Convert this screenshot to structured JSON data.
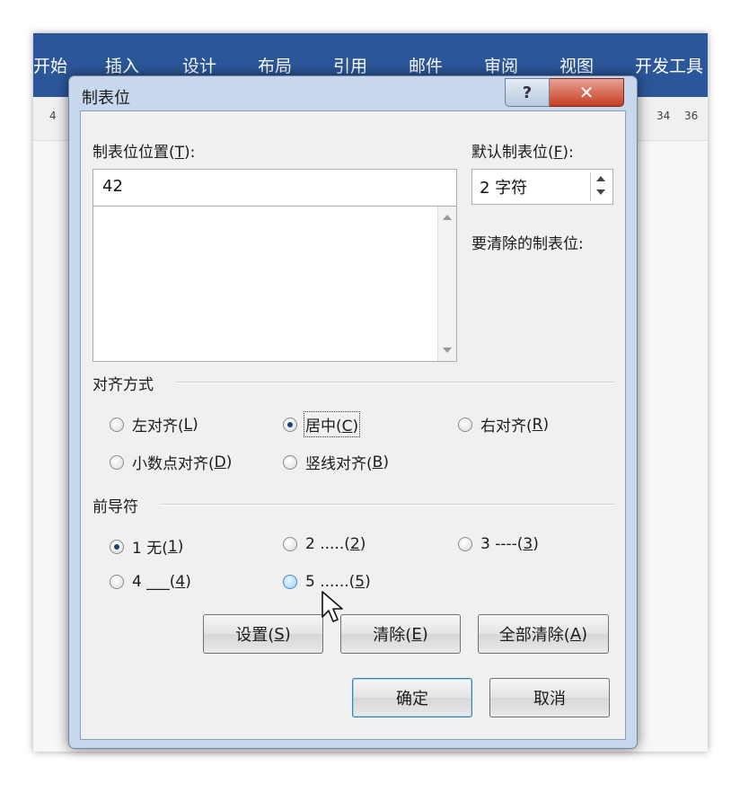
{
  "word": {
    "ribbon_tabs": [
      "开始",
      "插入",
      "设计",
      "布局",
      "引用",
      "邮件",
      "审阅",
      "视图",
      "开发工具"
    ],
    "ruler_left": "4",
    "ruler_right": [
      "34",
      "36"
    ]
  },
  "dialog": {
    "title": "制表位",
    "help_label": "?",
    "close_label": "✕",
    "tab_position": {
      "label_text": "制表位位置(",
      "label_key": "T",
      "label_end": "):",
      "value": "42",
      "list_items": []
    },
    "default_tab": {
      "label_text": "默认制表位(",
      "label_key": "F",
      "label_end": "):",
      "value": "2 字符"
    },
    "to_clear_label": "要清除的制表位:",
    "alignment": {
      "title": "对齐方式",
      "options": [
        {
          "text": "左对齐(",
          "key": "L",
          "end": ")",
          "checked": false
        },
        {
          "text": "居中(",
          "key": "C",
          "end": ")",
          "checked": true
        },
        {
          "text": "右对齐(",
          "key": "R",
          "end": ")",
          "checked": false
        },
        {
          "text": "小数点对齐(",
          "key": "D",
          "end": ")",
          "checked": false
        },
        {
          "text": "竖线对齐(",
          "key": "B",
          "end": ")",
          "checked": false
        }
      ]
    },
    "leader": {
      "title": "前导符",
      "options": [
        {
          "text": "1 无(",
          "key": "1",
          "end": ")",
          "checked": true
        },
        {
          "text": "2 .....(",
          "key": "2",
          "end": ")",
          "checked": false
        },
        {
          "text": "3 ----(",
          "key": "3",
          "end": ")",
          "checked": false
        },
        {
          "text": "4 ___(",
          "key": "4",
          "end": ")",
          "checked": false
        },
        {
          "text": "5 ......(",
          "key": "5",
          "end": ")",
          "checked": false,
          "hover": true
        }
      ]
    },
    "buttons": {
      "set": {
        "text": "设置(",
        "key": "S",
        "end": ")"
      },
      "clear": {
        "text": "清除(",
        "key": "E",
        "end": ")"
      },
      "clear_all": {
        "text": "全部清除(",
        "key": "A",
        "end": ")"
      },
      "ok": "确定",
      "cancel": "取消"
    }
  }
}
